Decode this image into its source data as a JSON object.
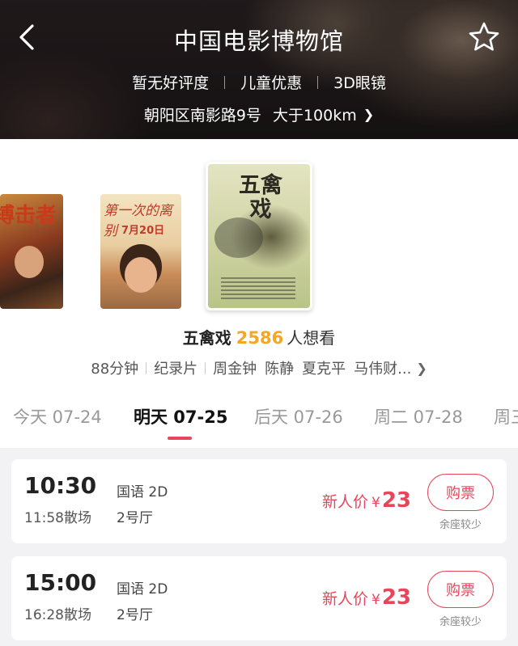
{
  "header": {
    "title": "中国电影博物馆",
    "tags": [
      "暂无好评度",
      "儿童优惠",
      "3D眼镜"
    ],
    "address": "朝阳区南影路9号",
    "distance": "大于100km",
    "back_icon": "chevron-left-icon",
    "favorite_icon": "star-outline-icon"
  },
  "posters": [
    {
      "title": "搏击者"
    },
    {
      "title": "第一次的离别",
      "date": "7月20日"
    },
    {
      "title": "五禽戏"
    }
  ],
  "movie": {
    "name": "五禽戏",
    "want_count": "2586",
    "want_label": "人想看",
    "duration": "88分钟",
    "genre": "纪录片",
    "cast": [
      "周金钟",
      "陈静",
      "夏克平",
      "马伟财..."
    ]
  },
  "date_tabs": [
    {
      "label": "今天 07-24",
      "active": false
    },
    {
      "label": "明天 07-25",
      "active": true
    },
    {
      "label": "后天 07-26",
      "active": false
    },
    {
      "label": "周二 07-28",
      "active": false
    },
    {
      "label": "周三",
      "active": false
    }
  ],
  "showtimes": [
    {
      "start": "10:30",
      "end": "11:58散场",
      "lang": "国语 2D",
      "hall": "2号厅",
      "price_label": "新人价",
      "currency": "¥",
      "price": "23",
      "buy": "购票",
      "seats": "余座较少"
    },
    {
      "start": "15:00",
      "end": "16:28散场",
      "lang": "国语 2D",
      "hall": "2号厅",
      "price_label": "新人价",
      "currency": "¥",
      "price": "23",
      "buy": "购票",
      "seats": "余座较少"
    }
  ],
  "colors": {
    "accent": "#e8445a",
    "want": "#f5a623"
  }
}
